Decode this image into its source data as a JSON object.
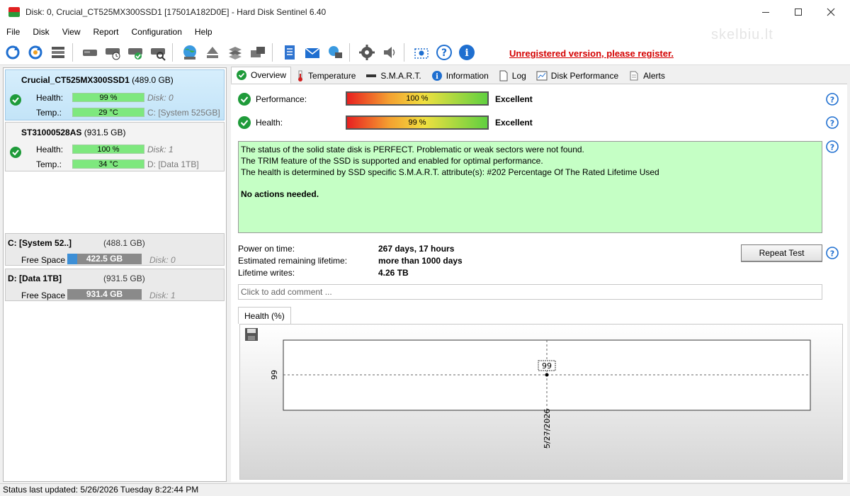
{
  "window": {
    "title": "Disk: 0, Crucial_CT525MX300SSD1 [17501A182D0E]  -  Hard Disk Sentinel 6.40"
  },
  "menu": [
    "File",
    "Disk",
    "View",
    "Report",
    "Configuration",
    "Help"
  ],
  "toolbar": {
    "register_text": "Unregistered version, please register.",
    "watermark": "skelbiu.lt"
  },
  "disks": [
    {
      "name": "Crucial_CT525MX300SSD1",
      "size": "(489.0 GB)",
      "health_label": "Health:",
      "health": "99 %",
      "health_value": 99,
      "disk_ref": "Disk: 0",
      "temp_label": "Temp.:",
      "temp": "29 °C",
      "drive": "C: [System 525GB]"
    },
    {
      "name": "ST31000528AS",
      "size": "(931.5 GB)",
      "health_label": "Health:",
      "health": "100 %",
      "health_value": 100,
      "disk_ref": "Disk: 1",
      "temp_label": "Temp.:",
      "temp": "34 °C",
      "drive": "D: [Data 1TB]"
    }
  ],
  "volumes": [
    {
      "name": "C: [System 52..]",
      "size": "(488.1 GB)",
      "free_label": "Free Space",
      "free": "422.5 GB",
      "free_fraction": 0.13,
      "disk_ref": "Disk: 0"
    },
    {
      "name": "D: [Data 1TB]",
      "size": "(931.5 GB)",
      "free_label": "Free Space",
      "free": "931.4 GB",
      "free_fraction": 0.0,
      "disk_ref": "Disk: 1"
    }
  ],
  "tabs": [
    "Overview",
    "Temperature",
    "S.M.A.R.T.",
    "Information",
    "Log",
    "Disk Performance",
    "Alerts"
  ],
  "overview": {
    "performance_label": "Performance:",
    "performance_value": "100 %",
    "performance_text": "Excellent",
    "health_label": "Health:",
    "health_value": "99 %",
    "health_text": "Excellent",
    "status_lines": [
      "The status of the solid state disk is PERFECT. Problematic or weak sectors were not found.",
      "The TRIM feature of the SSD is supported and enabled for optimal performance.",
      "The health is determined by SSD specific S.M.A.R.T. attribute(s):  #202 Percentage Of The Rated Lifetime Used"
    ],
    "action": "No actions needed.",
    "power_on_label": "Power on time:",
    "power_on_value": "267 days, 17 hours",
    "remaining_label": "Estimated remaining lifetime:",
    "remaining_value": "more than 1000 days",
    "writes_label": "Lifetime writes:",
    "writes_value": "4.26 TB",
    "repeat_button": "Repeat Test",
    "comment_placeholder": "Click to add comment ...",
    "graph_tab": "Health (%)"
  },
  "chart_data": {
    "type": "line",
    "x": [
      "5/27/2026"
    ],
    "values": [
      99
    ],
    "y_tick": "99",
    "point_label": "99"
  },
  "statusbar": {
    "text": "Status last updated: 5/26/2026 Tuesday 8:22:44 PM"
  },
  "colors": {
    "register": "#d40000",
    "status_box": "#c5ffc5",
    "health_bar": "#7ee87e",
    "selected_disk": "#d6eefc"
  }
}
